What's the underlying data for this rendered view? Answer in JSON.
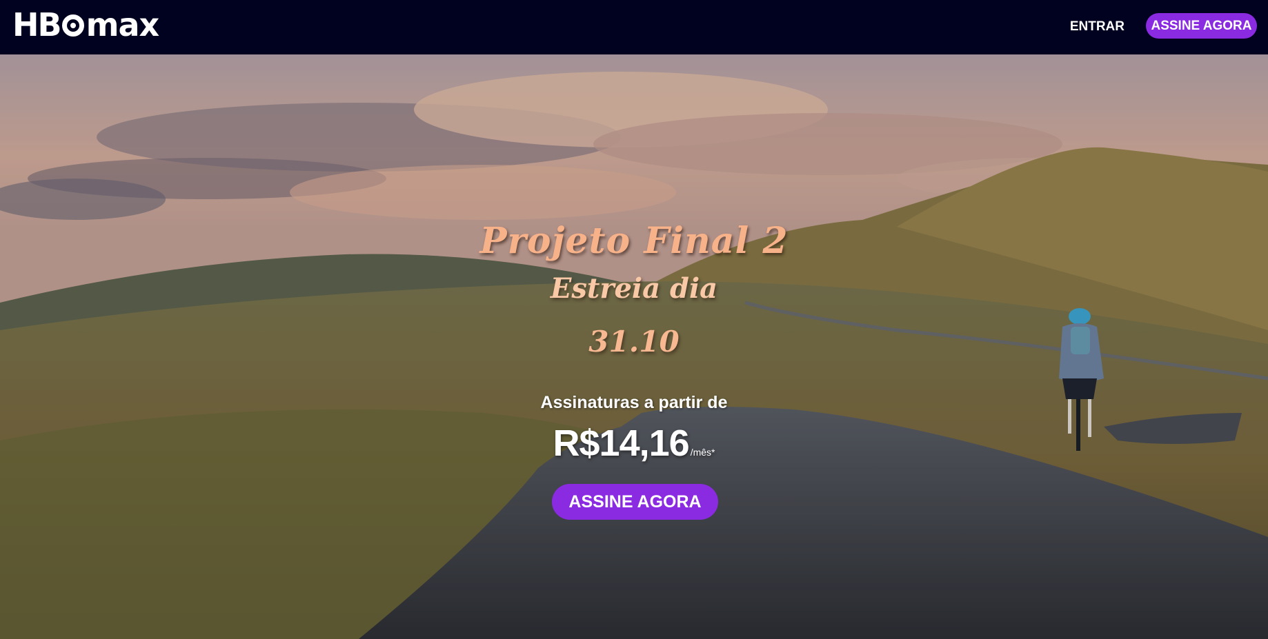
{
  "header": {
    "logo_hbo": "HB",
    "logo_max": "max",
    "login_label": "ENTRAR",
    "subscribe_label": "ASSINE AGORA"
  },
  "hero": {
    "title": "Projeto Final 2",
    "subtitle": "Estreia dia",
    "date": "31.10",
    "price_label": "Assinaturas a partir de",
    "price": "R$14,16",
    "price_unit": "/mês*",
    "cta_label": "ASSINE AGORA"
  },
  "colors": {
    "header_bg": "#010220",
    "accent": "#8a2be2",
    "title_color": "#f7b28a"
  },
  "icons": {
    "logo": "hbo-max-logo"
  }
}
